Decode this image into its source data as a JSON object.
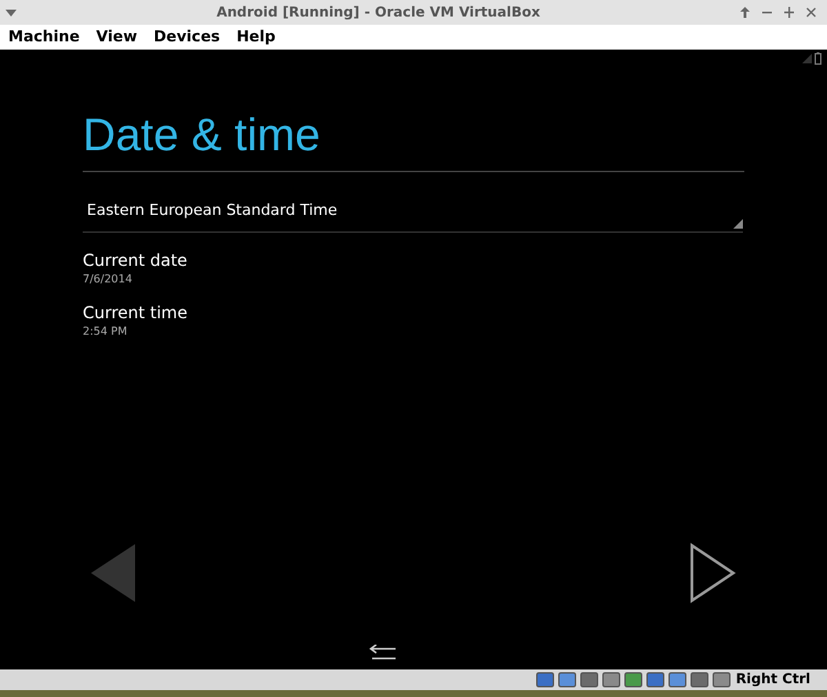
{
  "window": {
    "title": "Android [Running] - Oracle VM VirtualBox"
  },
  "menu": [
    "Machine",
    "View",
    "Devices",
    "Help"
  ],
  "screen": {
    "heading": "Date & time",
    "timezone": "Eastern European Standard Time",
    "settings": [
      {
        "label": "Current date",
        "value": "7/6/2014"
      },
      {
        "label": "Current time",
        "value": "2:54 PM"
      }
    ]
  },
  "status_bar": {
    "host_key": "Right Ctrl"
  }
}
